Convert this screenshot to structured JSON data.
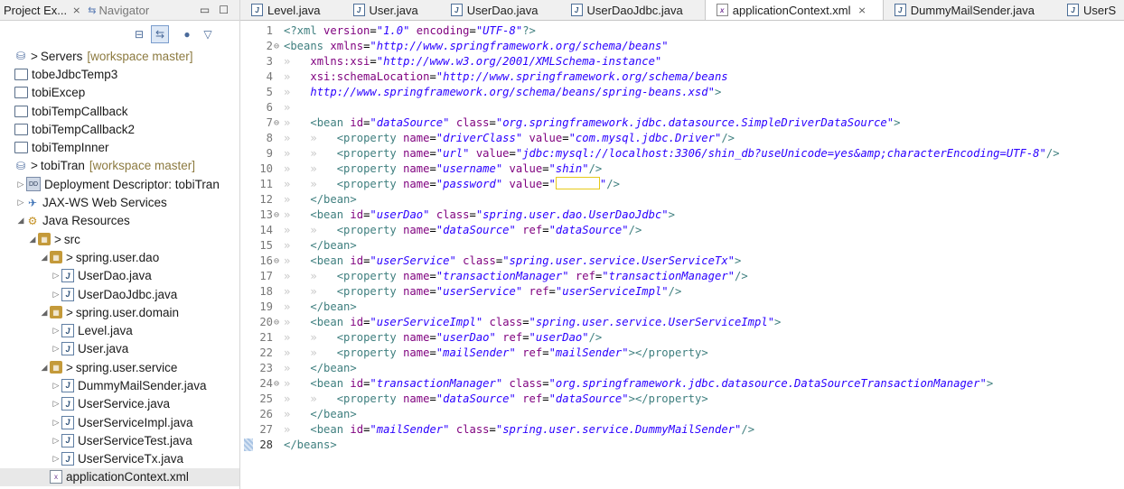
{
  "left_panel": {
    "tab_project": "Project Ex...",
    "tab_close": "⨯",
    "tab_navigator": "Navigator",
    "tree": [
      {
        "indent": 0,
        "arrow": "",
        "icon": "server-icon",
        "glyph": "⛁",
        "prefix": "> ",
        "label": "Servers",
        "tag": "[workspace master]"
      },
      {
        "indent": 0,
        "arrow": "",
        "icon": "folder-icon",
        "glyph": "",
        "prefix": "",
        "label": "tobeJdbcTemp3",
        "tag": ""
      },
      {
        "indent": 0,
        "arrow": "",
        "icon": "folder-icon",
        "glyph": "",
        "prefix": "",
        "label": "tobiExcep",
        "tag": ""
      },
      {
        "indent": 0,
        "arrow": "",
        "icon": "folder-icon",
        "glyph": "",
        "prefix": "",
        "label": "tobiTempCallback",
        "tag": ""
      },
      {
        "indent": 0,
        "arrow": "",
        "icon": "folder-icon",
        "glyph": "",
        "prefix": "",
        "label": "tobiTempCallback2",
        "tag": ""
      },
      {
        "indent": 0,
        "arrow": "",
        "icon": "folder-icon",
        "glyph": "",
        "prefix": "",
        "label": "tobiTempInner",
        "tag": ""
      },
      {
        "indent": 0,
        "arrow": "",
        "icon": "project-icon",
        "glyph": "⛁",
        "prefix": "> ",
        "label": "tobiTran",
        "tag": "[workspace master]"
      },
      {
        "indent": 1,
        "arrow": "▷",
        "icon": "deployment-descriptor-icon",
        "glyph": "DD",
        "prefix": "",
        "label": "Deployment Descriptor: tobiTran",
        "tag": ""
      },
      {
        "indent": 1,
        "arrow": "▷",
        "icon": "web-services-icon",
        "glyph": "✈",
        "prefix": "",
        "label": "JAX-WS Web Services",
        "tag": ""
      },
      {
        "indent": 1,
        "arrow": "◢",
        "icon": "java-resources-icon",
        "glyph": "⚙",
        "prefix": "",
        "label": "Java Resources",
        "tag": ""
      },
      {
        "indent": 2,
        "arrow": "◢",
        "icon": "source-folder-icon",
        "glyph": "▦",
        "prefix": "> ",
        "label": "src",
        "tag": ""
      },
      {
        "indent": 3,
        "arrow": "◢",
        "icon": "package-icon",
        "glyph": "▦",
        "prefix": "> ",
        "label": "spring.user.dao",
        "tag": ""
      },
      {
        "indent": 4,
        "arrow": "▷",
        "icon": "java-interface-icon",
        "glyph": "J",
        "prefix": "",
        "label": "UserDao.java",
        "tag": ""
      },
      {
        "indent": 4,
        "arrow": "▷",
        "icon": "java-file-icon",
        "glyph": "J",
        "prefix": "",
        "label": "UserDaoJdbc.java",
        "tag": ""
      },
      {
        "indent": 3,
        "arrow": "◢",
        "icon": "package-icon",
        "glyph": "▦",
        "prefix": "> ",
        "label": "spring.user.domain",
        "tag": ""
      },
      {
        "indent": 4,
        "arrow": "▷",
        "icon": "java-enum-icon",
        "glyph": "J",
        "prefix": "",
        "label": "Level.java",
        "tag": ""
      },
      {
        "indent": 4,
        "arrow": "▷",
        "icon": "java-file-icon",
        "glyph": "J",
        "prefix": "",
        "label": "User.java",
        "tag": ""
      },
      {
        "indent": 3,
        "arrow": "◢",
        "icon": "package-icon",
        "glyph": "▦",
        "prefix": "> ",
        "label": "spring.user.service",
        "tag": ""
      },
      {
        "indent": 4,
        "arrow": "▷",
        "icon": "java-file-icon",
        "glyph": "J",
        "prefix": "",
        "label": "DummyMailSender.java",
        "tag": ""
      },
      {
        "indent": 4,
        "arrow": "▷",
        "icon": "java-interface-icon",
        "glyph": "J",
        "prefix": "",
        "label": "UserService.java",
        "tag": ""
      },
      {
        "indent": 4,
        "arrow": "▷",
        "icon": "java-file-icon",
        "glyph": "J",
        "prefix": "",
        "label": "UserServiceImpl.java",
        "tag": ""
      },
      {
        "indent": 4,
        "arrow": "▷",
        "icon": "java-file-icon",
        "glyph": "J",
        "prefix": "",
        "label": "UserServiceTest.java",
        "tag": ""
      },
      {
        "indent": 4,
        "arrow": "▷",
        "icon": "java-file-icon",
        "glyph": "J",
        "prefix": "",
        "label": "UserServiceTx.java",
        "tag": ""
      },
      {
        "indent": 3,
        "arrow": "",
        "icon": "xml-file-icon",
        "glyph": "x",
        "prefix": "",
        "label": "applicationContext.xml",
        "tag": "",
        "selected": true
      }
    ]
  },
  "editor": {
    "tabs": [
      {
        "label": "Level.java",
        "kind": "java"
      },
      {
        "label": "User.java",
        "kind": "java"
      },
      {
        "label": "UserDao.java",
        "kind": "java"
      },
      {
        "label": "UserDaoJdbc.java",
        "kind": "java"
      },
      {
        "label": "applicationContext.xml",
        "kind": "xml",
        "active": true
      },
      {
        "label": "DummyMailSender.java",
        "kind": "java"
      },
      {
        "label": "UserS",
        "kind": "java"
      }
    ],
    "tab_close": "⨯",
    "lines": [
      {
        "n": "1",
        "fold": "",
        "ws": 0,
        "parts": [
          [
            "t",
            "<?xml "
          ],
          [
            "a",
            "version"
          ],
          [
            "p",
            "="
          ],
          [
            "s",
            "\"1.0\""
          ],
          [
            "p",
            " "
          ],
          [
            "a",
            "encoding"
          ],
          [
            "p",
            "="
          ],
          [
            "s",
            "\"UTF-8\""
          ],
          [
            "t",
            "?>"
          ]
        ]
      },
      {
        "n": "2",
        "fold": "⊖",
        "ws": 0,
        "parts": [
          [
            "t",
            "<beans "
          ],
          [
            "a",
            "xmlns"
          ],
          [
            "p",
            "="
          ],
          [
            "s",
            "\"http://www.springframework.org/schema/beans\""
          ]
        ]
      },
      {
        "n": "3",
        "fold": "",
        "ws": 1,
        "parts": [
          [
            "a",
            "xmlns:xsi"
          ],
          [
            "p",
            "="
          ],
          [
            "s",
            "\"http://www.w3.org/2001/XMLSchema-instance\""
          ]
        ]
      },
      {
        "n": "4",
        "fold": "",
        "ws": 1,
        "parts": [
          [
            "a",
            "xsi:schemaLocation"
          ],
          [
            "p",
            "="
          ],
          [
            "s",
            "\"http://www.springframework.org/schema/beans"
          ]
        ]
      },
      {
        "n": "5",
        "fold": "",
        "ws": 1,
        "parts": [
          [
            "s",
            "http://www.springframework.org/schema/beans/spring-beans.xsd\""
          ],
          [
            "t",
            ">"
          ]
        ]
      },
      {
        "n": "6",
        "fold": "",
        "ws": 1,
        "parts": []
      },
      {
        "n": "7",
        "fold": "⊖",
        "ws": 1,
        "parts": [
          [
            "t",
            "<bean "
          ],
          [
            "a",
            "id"
          ],
          [
            "p",
            "="
          ],
          [
            "s",
            "\"dataSource\""
          ],
          [
            "p",
            " "
          ],
          [
            "a",
            "class"
          ],
          [
            "p",
            "="
          ],
          [
            "s",
            "\"org.springframework.jdbc.datasource.SimpleDriverDataSource\""
          ],
          [
            "t",
            ">"
          ]
        ]
      },
      {
        "n": "8",
        "fold": "",
        "ws": 2,
        "parts": [
          [
            "t",
            "<property "
          ],
          [
            "a",
            "name"
          ],
          [
            "p",
            "="
          ],
          [
            "s",
            "\"driverClass\""
          ],
          [
            "p",
            " "
          ],
          [
            "a",
            "value"
          ],
          [
            "p",
            "="
          ],
          [
            "s",
            "\"com.mysql.jdbc.Driver\""
          ],
          [
            "t",
            "/>"
          ]
        ]
      },
      {
        "n": "9",
        "fold": "",
        "ws": 2,
        "parts": [
          [
            "t",
            "<property "
          ],
          [
            "a",
            "name"
          ],
          [
            "p",
            "="
          ],
          [
            "s",
            "\"url\""
          ],
          [
            "p",
            " "
          ],
          [
            "a",
            "value"
          ],
          [
            "p",
            "="
          ],
          [
            "s",
            "\"jdbc:mysql://localhost:3306/shin_db?useUnicode=yes&amp;characterEncoding=UTF-8\""
          ],
          [
            "t",
            "/>"
          ]
        ]
      },
      {
        "n": "10",
        "fold": "",
        "ws": 2,
        "parts": [
          [
            "t",
            "<property "
          ],
          [
            "a",
            "name"
          ],
          [
            "p",
            "="
          ],
          [
            "s",
            "\"username\""
          ],
          [
            "p",
            " "
          ],
          [
            "a",
            "value"
          ],
          [
            "p",
            "="
          ],
          [
            "s",
            "\"shin\""
          ],
          [
            "t",
            "/>"
          ]
        ]
      },
      {
        "n": "11",
        "fold": "",
        "ws": 2,
        "parts": [
          [
            "t",
            "<property "
          ],
          [
            "a",
            "name"
          ],
          [
            "p",
            "="
          ],
          [
            "s",
            "\"password\""
          ],
          [
            "p",
            " "
          ],
          [
            "a",
            "value"
          ],
          [
            "p",
            "="
          ],
          [
            "s",
            "\""
          ],
          [
            "box",
            ""
          ],
          [
            "s",
            "\""
          ],
          [
            "t",
            "/>"
          ]
        ]
      },
      {
        "n": "12",
        "fold": "",
        "ws": 1,
        "parts": [
          [
            "t",
            "</bean>"
          ]
        ]
      },
      {
        "n": "13",
        "fold": "⊖",
        "ws": 1,
        "parts": [
          [
            "t",
            "<bean "
          ],
          [
            "a",
            "id"
          ],
          [
            "p",
            "="
          ],
          [
            "s",
            "\"userDao\""
          ],
          [
            "p",
            " "
          ],
          [
            "a",
            "class"
          ],
          [
            "p",
            "="
          ],
          [
            "s",
            "\"spring.user.dao.UserDaoJdbc\""
          ],
          [
            "t",
            ">"
          ]
        ]
      },
      {
        "n": "14",
        "fold": "",
        "ws": 2,
        "parts": [
          [
            "t",
            "<property "
          ],
          [
            "a",
            "name"
          ],
          [
            "p",
            "="
          ],
          [
            "s",
            "\"dataSource\""
          ],
          [
            "p",
            " "
          ],
          [
            "a",
            "ref"
          ],
          [
            "p",
            "="
          ],
          [
            "s",
            "\"dataSource\""
          ],
          [
            "t",
            "/>"
          ]
        ]
      },
      {
        "n": "15",
        "fold": "",
        "ws": 1,
        "parts": [
          [
            "t",
            "</bean>"
          ]
        ]
      },
      {
        "n": "16",
        "fold": "⊖",
        "ws": 1,
        "parts": [
          [
            "t",
            "<bean "
          ],
          [
            "a",
            "id"
          ],
          [
            "p",
            "="
          ],
          [
            "s",
            "\"userService\""
          ],
          [
            "p",
            " "
          ],
          [
            "a",
            "class"
          ],
          [
            "p",
            "="
          ],
          [
            "s",
            "\"spring.user.service.UserServiceTx\""
          ],
          [
            "t",
            ">"
          ]
        ]
      },
      {
        "n": "17",
        "fold": "",
        "ws": 2,
        "parts": [
          [
            "t",
            "<property "
          ],
          [
            "a",
            "name"
          ],
          [
            "p",
            "="
          ],
          [
            "s",
            "\"transactionManager\""
          ],
          [
            "p",
            " "
          ],
          [
            "a",
            "ref"
          ],
          [
            "p",
            "="
          ],
          [
            "s",
            "\"transactionManager\""
          ],
          [
            "t",
            "/>"
          ]
        ]
      },
      {
        "n": "18",
        "fold": "",
        "ws": 2,
        "parts": [
          [
            "t",
            "<property "
          ],
          [
            "a",
            "name"
          ],
          [
            "p",
            "="
          ],
          [
            "s",
            "\"userService\""
          ],
          [
            "p",
            " "
          ],
          [
            "a",
            "ref"
          ],
          [
            "p",
            "="
          ],
          [
            "s",
            "\"userServiceImpl\""
          ],
          [
            "t",
            "/>"
          ]
        ]
      },
      {
        "n": "19",
        "fold": "",
        "ws": 1,
        "parts": [
          [
            "t",
            "</bean>"
          ]
        ]
      },
      {
        "n": "20",
        "fold": "⊖",
        "ws": 1,
        "parts": [
          [
            "t",
            "<bean "
          ],
          [
            "a",
            "id"
          ],
          [
            "p",
            "="
          ],
          [
            "s",
            "\"userServiceImpl\""
          ],
          [
            "p",
            " "
          ],
          [
            "a",
            "class"
          ],
          [
            "p",
            "="
          ],
          [
            "s",
            "\"spring.user.service.UserServiceImpl\""
          ],
          [
            "t",
            ">"
          ]
        ]
      },
      {
        "n": "21",
        "fold": "",
        "ws": 2,
        "parts": [
          [
            "t",
            "<property "
          ],
          [
            "a",
            "name"
          ],
          [
            "p",
            "="
          ],
          [
            "s",
            "\"userDao\""
          ],
          [
            "p",
            " "
          ],
          [
            "a",
            "ref"
          ],
          [
            "p",
            "="
          ],
          [
            "s",
            "\"userDao\""
          ],
          [
            "t",
            "/>"
          ]
        ]
      },
      {
        "n": "22",
        "fold": "",
        "ws": 2,
        "parts": [
          [
            "t",
            "<property "
          ],
          [
            "a",
            "name"
          ],
          [
            "p",
            "="
          ],
          [
            "s",
            "\"mailSender\""
          ],
          [
            "p",
            " "
          ],
          [
            "a",
            "ref"
          ],
          [
            "p",
            "="
          ],
          [
            "s",
            "\"mailSender\""
          ],
          [
            "t",
            "></property>"
          ]
        ]
      },
      {
        "n": "23",
        "fold": "",
        "ws": 1,
        "parts": [
          [
            "t",
            "</bean>"
          ]
        ]
      },
      {
        "n": "24",
        "fold": "⊖",
        "ws": 1,
        "parts": [
          [
            "t",
            "<bean "
          ],
          [
            "a",
            "id"
          ],
          [
            "p",
            "="
          ],
          [
            "s",
            "\"transactionManager\""
          ],
          [
            "p",
            " "
          ],
          [
            "a",
            "class"
          ],
          [
            "p",
            "="
          ],
          [
            "s",
            "\"org.springframework.jdbc.datasource.DataSourceTransactionManager\""
          ],
          [
            "t",
            ">"
          ]
        ]
      },
      {
        "n": "25",
        "fold": "",
        "ws": 2,
        "parts": [
          [
            "t",
            "<property "
          ],
          [
            "a",
            "name"
          ],
          [
            "p",
            "="
          ],
          [
            "s",
            "\"dataSource\""
          ],
          [
            "p",
            " "
          ],
          [
            "a",
            "ref"
          ],
          [
            "p",
            "="
          ],
          [
            "s",
            "\"dataSource\""
          ],
          [
            "t",
            "></property>"
          ]
        ]
      },
      {
        "n": "26",
        "fold": "",
        "ws": 1,
        "parts": [
          [
            "t",
            "</bean>"
          ]
        ]
      },
      {
        "n": "27",
        "fold": "",
        "ws": 1,
        "parts": [
          [
            "t",
            "<bean "
          ],
          [
            "a",
            "id"
          ],
          [
            "p",
            "="
          ],
          [
            "s",
            "\"mailSender\""
          ],
          [
            "p",
            " "
          ],
          [
            "a",
            "class"
          ],
          [
            "p",
            "="
          ],
          [
            "s",
            "\"spring.user.service.DummyMailSender\""
          ],
          [
            "t",
            "/>"
          ]
        ]
      },
      {
        "n": "28",
        "fold": "",
        "ws": 0,
        "parts": [
          [
            "t",
            "</beans>"
          ]
        ],
        "current": true
      }
    ]
  },
  "colors": {
    "tag": "#3f7f7f",
    "attr": "#7f007f",
    "string": "#2a00ff"
  }
}
